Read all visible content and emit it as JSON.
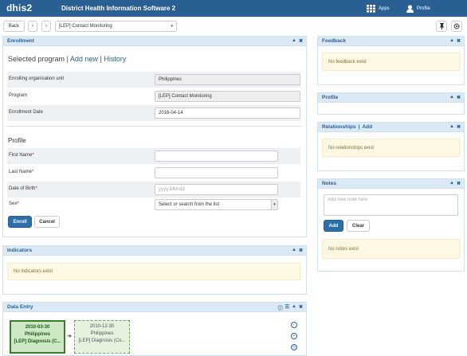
{
  "header": {
    "logo": "dhis2",
    "title": "District Health Information Software 2",
    "apps": "Apps",
    "profile": "Profile"
  },
  "toolbar": {
    "back": "Back",
    "prev": "‹",
    "next": "›",
    "program": "[LEP] Contact Monitoring",
    "caret": "▾"
  },
  "enrollment": {
    "title": "Enrollment",
    "heading_selected": "Selected program",
    "sep1": "|",
    "add_new": "Add new",
    "sep2": "|",
    "history": "History",
    "rows": [
      {
        "label": "Enrolling organisation unit",
        "value": "Philippines"
      },
      {
        "label": "Program",
        "value": "[LEP] Contact Monitoring"
      },
      {
        "label": "Enrollment Date",
        "value": "2016-04-14"
      }
    ],
    "profile_title": "Profile",
    "first_name": "First Name",
    "last_name": "Last Name",
    "dob": "Date of Birth",
    "dob_placeholder": "yyyy-MM-dd",
    "sex": "Sex",
    "sex_placeholder": "Select or search from the list",
    "required": "*",
    "enroll": "Enroll",
    "cancel": "Cancel"
  },
  "indicators": {
    "title": "Indicators",
    "empty": "No indicators exist"
  },
  "dataentry": {
    "title": "Data Entry",
    "events": [
      {
        "date": "2010-03-30",
        "org": "Philippines",
        "stage": "[LEP] Diagnosis (C..."
      },
      {
        "date": "2010-12-30",
        "org": "Philippines",
        "stage": "[LEP] Diagnosis (Co..."
      }
    ],
    "arrow": "➔"
  },
  "feedback": {
    "title": "Feedback",
    "empty": "No feedback exist"
  },
  "profile_widget": {
    "title": "Profile"
  },
  "relationships": {
    "title": "Relationships",
    "sep": "|",
    "add": "Add",
    "empty": "No relationships exist"
  },
  "notes": {
    "title": "Notes",
    "placeholder": "Add new note here",
    "add": "Add",
    "clear": "Clear",
    "empty": "No notes exist"
  },
  "colors": {
    "brand": "#2a5f94",
    "panel_head": "#dbe9f5",
    "warn_bg": "#fcf8e3",
    "event_active": "#cde8c4",
    "event_done": "#e4f2de"
  },
  "icons": {
    "apps": "grid-icon",
    "profile": "user-icon",
    "pin": "pin-icon",
    "settings": "gear-icon",
    "collapse": "chevron-up-icon",
    "close": "close-icon"
  }
}
